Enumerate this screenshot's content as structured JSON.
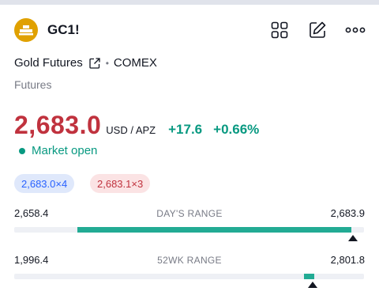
{
  "header": {
    "symbol": "GC1!",
    "icons": [
      "gold-bars-logo",
      "grid-icon",
      "edit-icon",
      "more-icon"
    ]
  },
  "instrument": {
    "name": "Gold Futures",
    "exchange": "COMEX",
    "category": "Futures"
  },
  "quote": {
    "price": "2,683.0",
    "currency": "USD / APZ",
    "change": "+17.6",
    "change_percent": "+0.66%",
    "market_status": "Market open"
  },
  "bid_ask": {
    "bid": "2,683.0×4",
    "ask": "2,683.1×3"
  },
  "days_range": {
    "label": "DAY'S RANGE",
    "low": "2,658.4",
    "high": "2,683.9",
    "fill_start_fraction": 0.18,
    "fill_end_fraction": 0.965,
    "marker_fraction": 0.968
  },
  "week52_range": {
    "label": "52WK RANGE",
    "low": "1,996.4",
    "high": "2,801.8",
    "fill_start_fraction": 0.828,
    "fill_end_fraction": 0.858,
    "marker_fraction": 0.853
  },
  "colors": {
    "price_down_red": "#c0323e",
    "positive_green": "#089981",
    "range_fill": "#22ab94",
    "bid_blue": "#2962ff",
    "logo_gold": "#e0a100"
  }
}
